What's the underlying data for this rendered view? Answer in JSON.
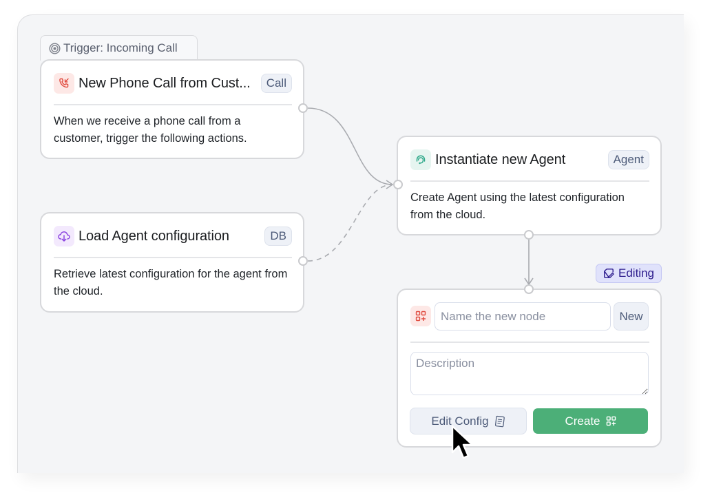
{
  "canvas": {
    "colors": {
      "background": "#f4f5f7",
      "edge": "#a9abb0",
      "accent_create": "#4caf78",
      "editing_badge_bg": "#e0e2fb",
      "editing_badge_text": "#2b1a8c"
    }
  },
  "trigger_group": {
    "icon": "target-icon",
    "label": "Trigger: Incoming Call"
  },
  "nodes": [
    {
      "id": "phone-call",
      "icon": "phone-incoming-icon",
      "icon_color": "#e04b3f",
      "icon_bg": "#fde8e6",
      "title": "New Phone Call from Cust...",
      "tag": "Call",
      "description": "When we receive a phone call from a customer, trigger the following actions."
    },
    {
      "id": "load-config",
      "icon": "cloud-download-icon",
      "icon_color": "#8b43e0",
      "icon_bg": "#f3e9fd",
      "title": "Load Agent configuration",
      "tag": "DB",
      "description": "Retrieve latest configuration for the agent from the cloud."
    },
    {
      "id": "instantiate-agent",
      "icon": "agent-headset-icon",
      "icon_color": "#2fa98a",
      "icon_bg": "#e6f5f0",
      "title": "Instantiate new Agent",
      "tag": "Agent",
      "description": "Create Agent using the latest configuration from the cloud."
    }
  ],
  "edges": [
    {
      "from": "phone-call",
      "to": "instantiate-agent",
      "style": "solid"
    },
    {
      "from": "load-config",
      "to": "instantiate-agent",
      "style": "dashed"
    },
    {
      "from": "instantiate-agent",
      "to": "new-node",
      "style": "solid"
    }
  ],
  "new_node": {
    "status_badge": {
      "icon": "edit-note-icon",
      "label": "Editing"
    },
    "icon": "add-grid-icon",
    "name_value": "",
    "name_placeholder": "Name the new node",
    "tag": "New",
    "description_value": "",
    "description_placeholder": "Description",
    "edit_config_label": "Edit Config",
    "edit_config_icon": "document-icon",
    "create_label": "Create",
    "create_icon": "add-grid-icon"
  }
}
